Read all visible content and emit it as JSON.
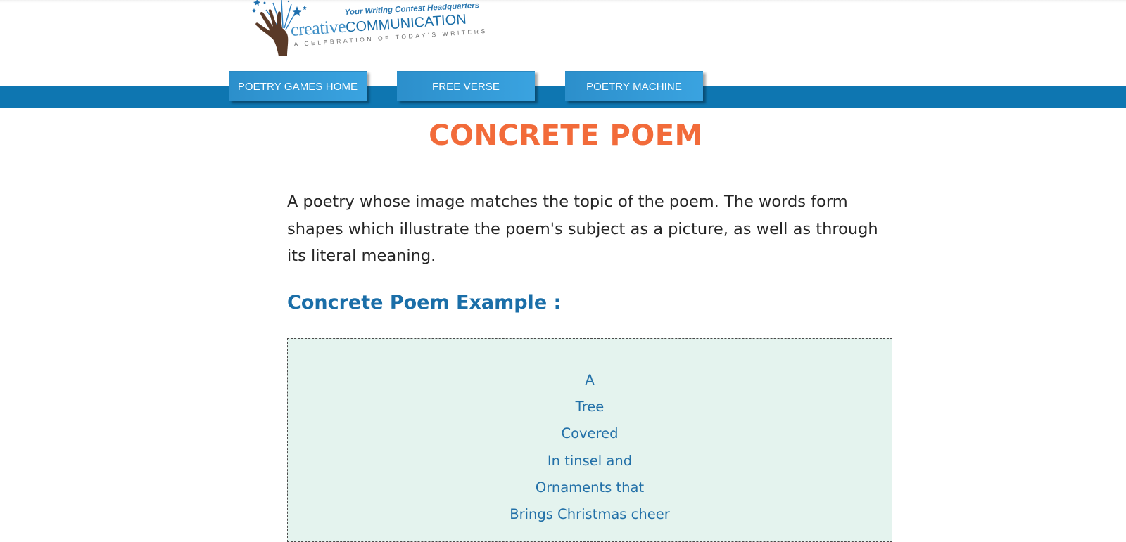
{
  "logo": {
    "tagline": "Your Writing Contest Headquarters",
    "word_part1": "creative",
    "word_part2": "COMMUNICATION",
    "subtitle": "A CELEBRATION OF TODAY'S WRITERS",
    "icon": "hand-fireworks-logo-icon"
  },
  "nav": {
    "items": [
      {
        "label": "POETRY GAMES HOME"
      },
      {
        "label": "FREE VERSE"
      },
      {
        "label": "POETRY MACHINE"
      }
    ]
  },
  "main": {
    "title": "CONCRETE POEM",
    "intro": "A poetry whose image matches the topic of the poem. The words form shapes which illustrate the poem's subject as a picture, as well as through its literal meaning.",
    "example_heading": "Concrete Poem Example :",
    "poem_lines": [
      "A",
      "Tree",
      "Covered",
      "In tinsel and",
      "Ornaments that",
      "Brings Christmas cheer"
    ]
  },
  "colors": {
    "nav_band": "#0e76b1",
    "nav_button": "#3aa3e0",
    "title": "#f26b3a",
    "heading": "#1a6ea8",
    "poem_text": "#2270a8",
    "poem_bg": "#e4f3ee"
  }
}
